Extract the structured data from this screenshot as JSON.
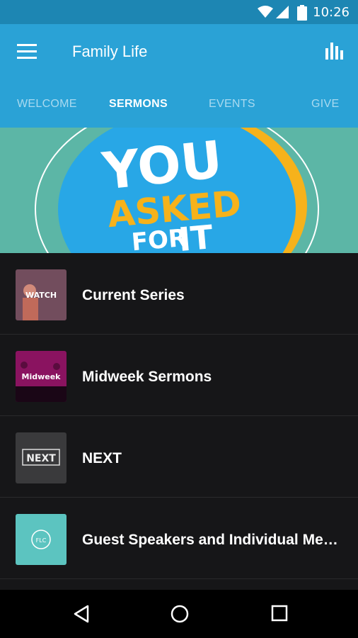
{
  "status": {
    "time": "10:26"
  },
  "appbar": {
    "title": "Family Life"
  },
  "tabs": [
    {
      "label": "WELCOME",
      "active": false
    },
    {
      "label": "SERMONS",
      "active": true
    },
    {
      "label": "EVENTS",
      "active": false
    },
    {
      "label": "GIVE",
      "active": false
    }
  ],
  "banner": {
    "line1": "YOU",
    "line2": "ASKED",
    "line3_a": "FOR",
    "line3_b": "IT"
  },
  "list": {
    "items": [
      {
        "label": "Current Series",
        "thumb_text": "WATCH"
      },
      {
        "label": "Midweek Sermons",
        "thumb_text": "Midweek"
      },
      {
        "label": "NEXT",
        "thumb_text": "NEXT"
      },
      {
        "label": "Guest Speakers and Individual Messages",
        "thumb_text": "FLC"
      }
    ]
  },
  "colors": {
    "statusbar": "#1d86b3",
    "appbar": "#2aa2d6",
    "list_bg": "#161618",
    "banner_bg": "#5cb6a6"
  }
}
